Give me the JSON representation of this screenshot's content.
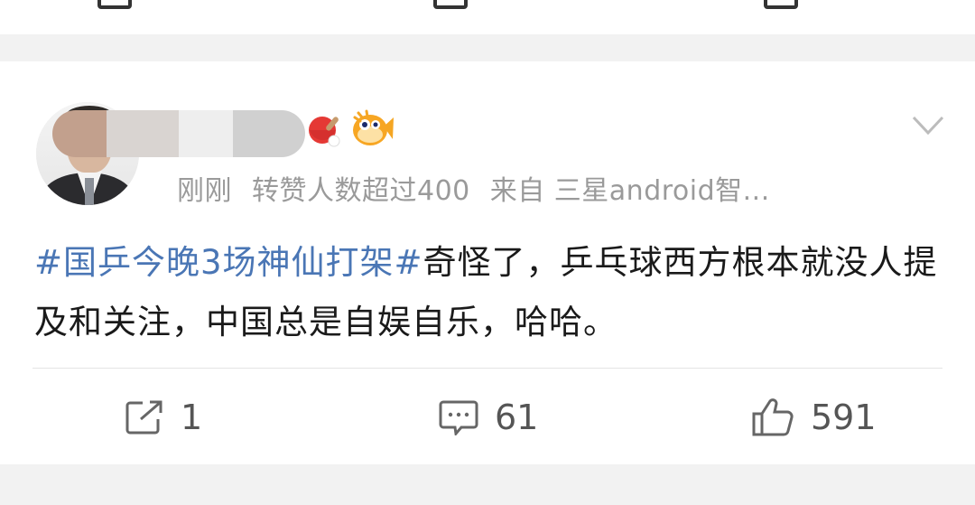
{
  "post": {
    "meta_time": "刚刚",
    "meta_likes": "转赞人数超过400",
    "meta_source": "来自 三星android智...",
    "hashtag": "#国乒今晚3场神仙打架#",
    "text_after_hashtag": "奇怪了，乒乓球西方根本就没人提及和关注，中国总是自娱自乐，哈哈。"
  },
  "actions": {
    "repost_count": "1",
    "comment_count": "61",
    "like_count": "591"
  },
  "icons": [
    "ping-pong-badge-icon",
    "blowfish-badge-icon",
    "chevron-down-icon",
    "repost-icon",
    "comment-icon",
    "like-icon"
  ],
  "colors": {
    "hashtag": "#4a76b5",
    "meta": "#9a9a9a",
    "body_text": "#1a1a1a",
    "background": "#f2f2f2"
  }
}
